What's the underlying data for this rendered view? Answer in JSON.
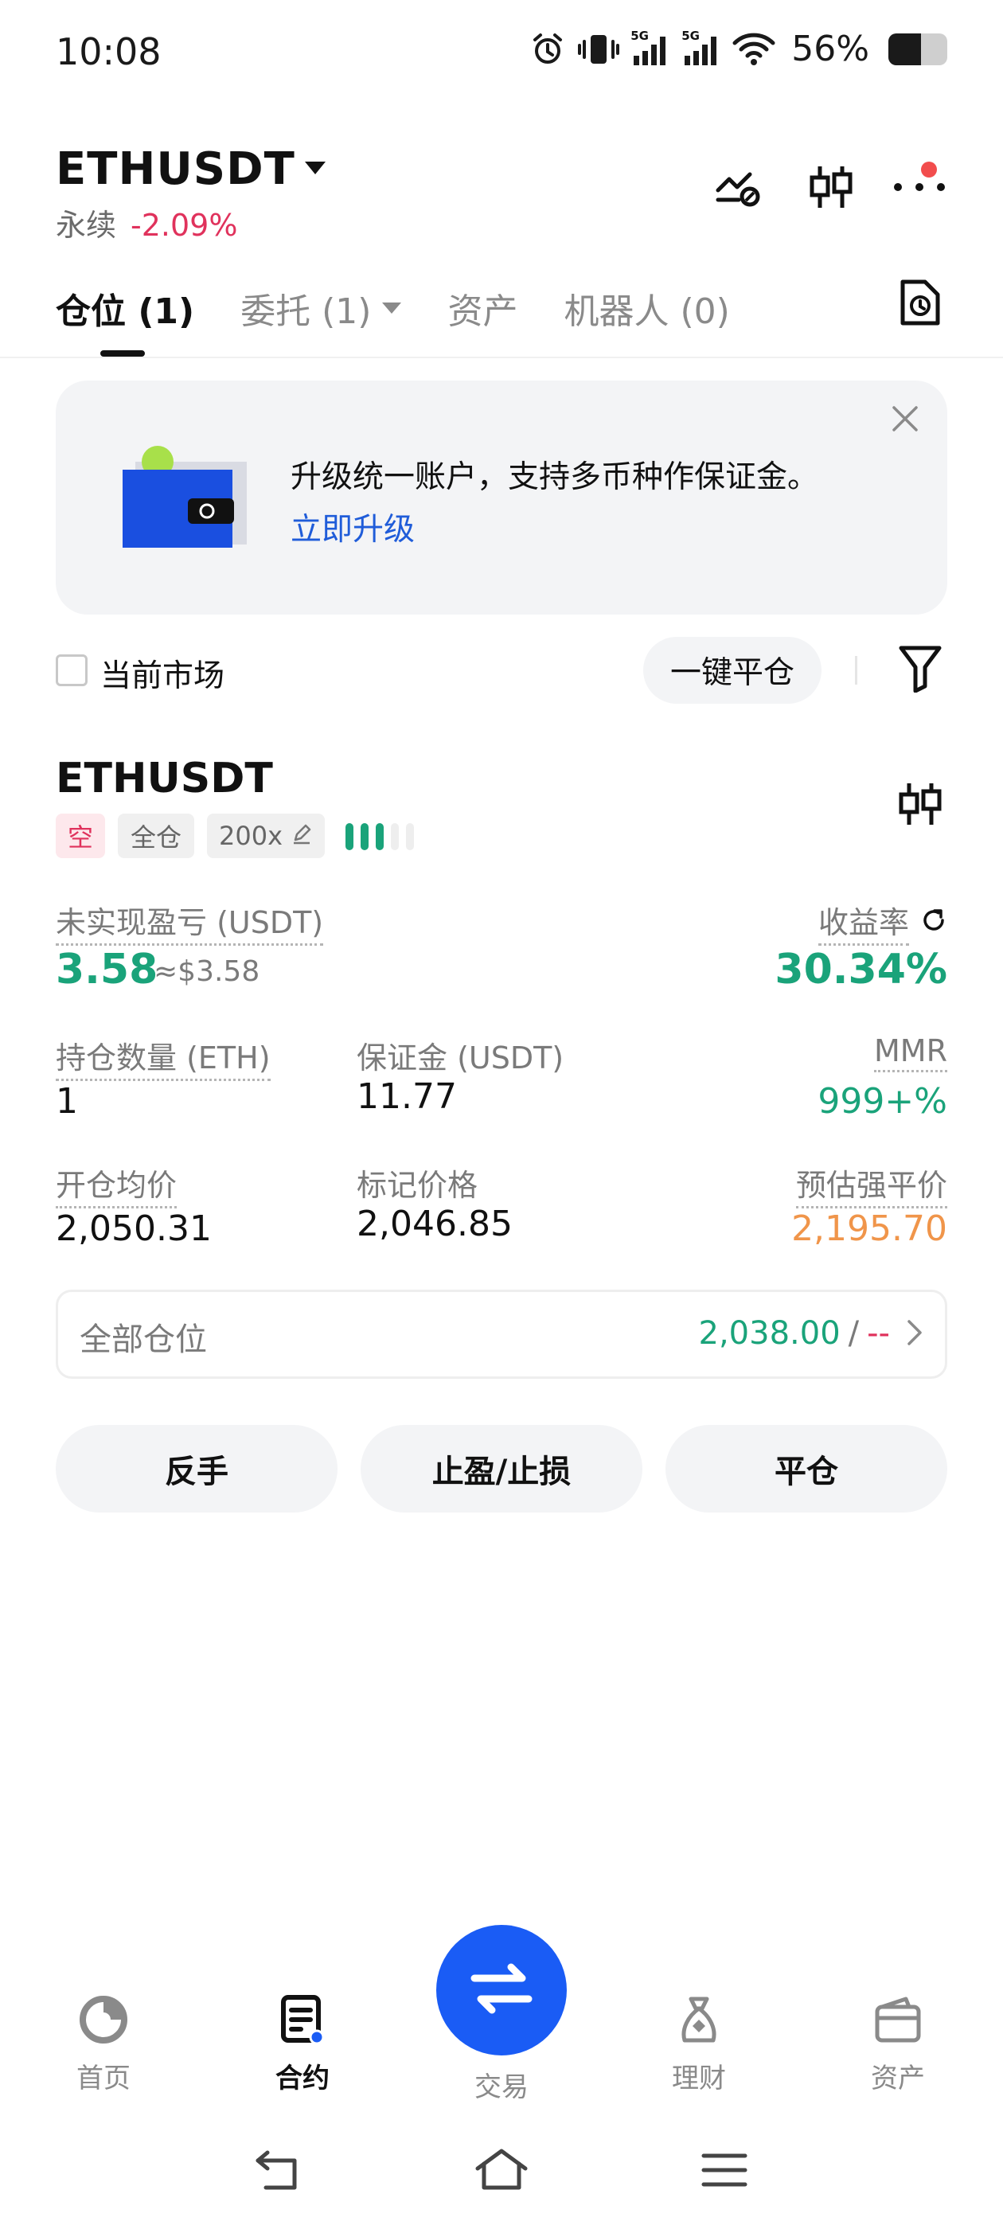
{
  "status_bar": {
    "time": "10:08",
    "network_1": "5G",
    "network_2": "5G",
    "battery_percent": "56%",
    "battery_level": 0.56,
    "icons": [
      "alarm-icon",
      "vibrate-icon",
      "signal-icon",
      "signal-icon",
      "wifi-icon",
      "battery-icon"
    ]
  },
  "header": {
    "symbol": "ETHUSDT",
    "contract_type": "永续",
    "change": "-2.09%",
    "icons": [
      "pnl-analysis-icon",
      "candlestick-chart-icon",
      "more-icon"
    ]
  },
  "tabs": [
    {
      "label": "仓位 (1)",
      "active": true
    },
    {
      "label": "委托 (1)",
      "active": false,
      "dropdown": true
    },
    {
      "label": "资产",
      "active": false
    },
    {
      "label": "机器人 (0)",
      "active": false
    }
  ],
  "banner": {
    "text": "升级统一账户，支持多币种作保证金。",
    "link": "立即升级"
  },
  "filters": {
    "current_market_label": "当前市场",
    "current_market_checked": false,
    "close_all_label": "一键平仓"
  },
  "position": {
    "symbol": "ETHUSDT",
    "side": "空",
    "margin_mode": "全仓",
    "leverage": "200x",
    "adl_level": 3,
    "adl_total": 5,
    "unrealized_pnl_label": "未实现盈亏 (USDT)",
    "unrealized_pnl": "3.58",
    "unrealized_pnl_approx": "≈$3.58",
    "roe_label": "收益率",
    "roe": "30.34%",
    "size_label": "持仓数量 (ETH)",
    "size": "1",
    "margin_label": "保证金 (USDT)",
    "margin": "11.77",
    "mmr_label": "MMR",
    "mmr": "999+%",
    "entry_price_label": "开仓均价",
    "entry_price": "2,050.31",
    "mark_price_label": "标记价格",
    "mark_price": "2,046.85",
    "liq_price_label": "预估强平价",
    "liq_price": "2,195.70",
    "all_positions_label": "全部仓位",
    "all_positions_value": "2,038.00",
    "all_positions_sep": "/",
    "all_positions_dash": "--",
    "actions": {
      "reverse": "反手",
      "tp_sl": "止盈/止损",
      "close": "平仓"
    }
  },
  "bottom_nav": {
    "home": "首页",
    "futures": "合约",
    "trade": "交易",
    "earn": "理财",
    "assets": "资产"
  },
  "colors": {
    "green": "#1aa37a",
    "red": "#e0325c",
    "orange": "#f0954a",
    "link_blue": "#1f5cd9",
    "trade_button": "#1a5cf5"
  }
}
